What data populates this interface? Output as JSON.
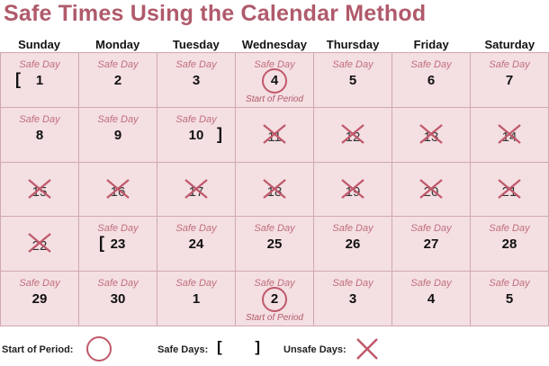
{
  "title": "Safe Times Using the Calendar Method",
  "days": [
    "Sunday",
    "Monday",
    "Tuesday",
    "Wednesday",
    "Thursday",
    "Friday",
    "Saturday"
  ],
  "safe_label": "Safe Day",
  "start_label": "Start of Period",
  "colors": {
    "accent": "#b05a6b",
    "cell_bg": "#f4dfe2",
    "grid_line": "#cfa9b0"
  },
  "cells": [
    {
      "num": "1",
      "safe": true,
      "open_bracket": true
    },
    {
      "num": "2",
      "safe": true
    },
    {
      "num": "3",
      "safe": true
    },
    {
      "num": "4",
      "safe": true,
      "circle": true,
      "start": true
    },
    {
      "num": "5",
      "safe": true
    },
    {
      "num": "6",
      "safe": true
    },
    {
      "num": "7",
      "safe": true
    },
    {
      "num": "8",
      "safe": true
    },
    {
      "num": "9",
      "safe": true
    },
    {
      "num": "10",
      "safe": true,
      "close_bracket": true
    },
    {
      "num": "11",
      "x": true
    },
    {
      "num": "12",
      "x": true
    },
    {
      "num": "13",
      "x": true
    },
    {
      "num": "14",
      "x": true
    },
    {
      "num": "15",
      "x": true
    },
    {
      "num": "16",
      "x": true
    },
    {
      "num": "17",
      "x": true
    },
    {
      "num": "18",
      "x": true
    },
    {
      "num": "19",
      "x": true
    },
    {
      "num": "20",
      "x": true
    },
    {
      "num": "21",
      "x": true
    },
    {
      "num": "22",
      "x": true
    },
    {
      "num": "23",
      "safe": true,
      "open_bracket": true
    },
    {
      "num": "24",
      "safe": true
    },
    {
      "num": "25",
      "safe": true
    },
    {
      "num": "26",
      "safe": true
    },
    {
      "num": "27",
      "safe": true
    },
    {
      "num": "28",
      "safe": true
    },
    {
      "num": "29",
      "safe": true
    },
    {
      "num": "30",
      "safe": true
    },
    {
      "num": "1",
      "safe": true
    },
    {
      "num": "2",
      "safe": true,
      "circle": true,
      "start": true
    },
    {
      "num": "3",
      "safe": true
    },
    {
      "num": "4",
      "safe": true
    },
    {
      "num": "5",
      "safe": true
    }
  ],
  "legend": {
    "start_of_period": "Start of Period:",
    "safe_days": "Safe Days:",
    "safe_days_symbol": "[ ]",
    "unsafe_days": "Unsafe Days:"
  }
}
